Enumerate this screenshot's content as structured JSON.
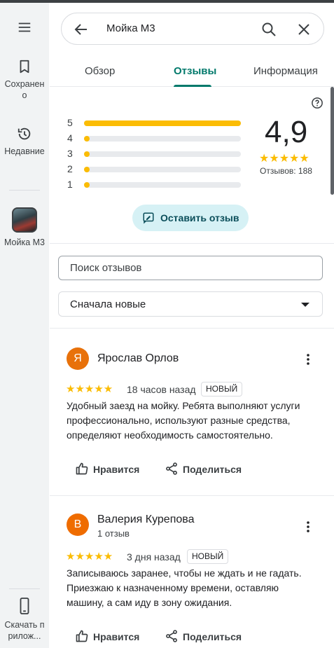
{
  "rail": {
    "saved_label": "Сохранено",
    "recent_label": "Недавние",
    "place_label": "Мойка М3",
    "download_label": "Скачать прилож..."
  },
  "search": {
    "query": "Мойка М3"
  },
  "tabs": [
    {
      "label": "Обзор"
    },
    {
      "label": "Отзывы"
    },
    {
      "label": "Информация"
    }
  ],
  "summary": {
    "rating": "4,9",
    "stars": "★★★★★",
    "count_label": "Отзывов: 188",
    "histogram": [
      {
        "stars": "5",
        "fraction": 1.0
      },
      {
        "stars": "4",
        "fraction": 0.03
      },
      {
        "stars": "3",
        "fraction": 0.01
      },
      {
        "stars": "2",
        "fraction": 0.01
      },
      {
        "stars": "1",
        "fraction": 0.03
      }
    ],
    "write_review_label": "Оставить отзыв"
  },
  "review_search": {
    "placeholder": "Поиск отзывов"
  },
  "sort": {
    "selected": "Сначала новые"
  },
  "reviews": [
    {
      "initial": "Я",
      "avatar_color": "#e8710a",
      "name": "Ярослав Орлов",
      "sub": "",
      "stars": "★★★★★",
      "time": "18 часов назад",
      "badge": "НОВЫЙ",
      "text": "Удобный заезд на мойку. Ребята выполняют услуги профессионально, используют разные средства, определяют необходимость самостоятельно.",
      "like_label": "Нравится",
      "share_label": "Поделиться"
    },
    {
      "initial": "В",
      "avatar_color": "#ef6c00",
      "name": "Валерия Курепова",
      "sub": "1 отзыв",
      "stars": "★★★★★",
      "time": "3 дня назад",
      "badge": "НОВЫЙ",
      "text": "Записываюсь заранее, чтобы не ждать и не гадать. Приезжаю к назначенному времени, оставляю машину, а сам иду в зону ожидания.",
      "like_label": "Нравится",
      "share_label": "Поделиться"
    }
  ],
  "colors": {
    "accent": "#00796b",
    "star": "#fbbc04"
  }
}
